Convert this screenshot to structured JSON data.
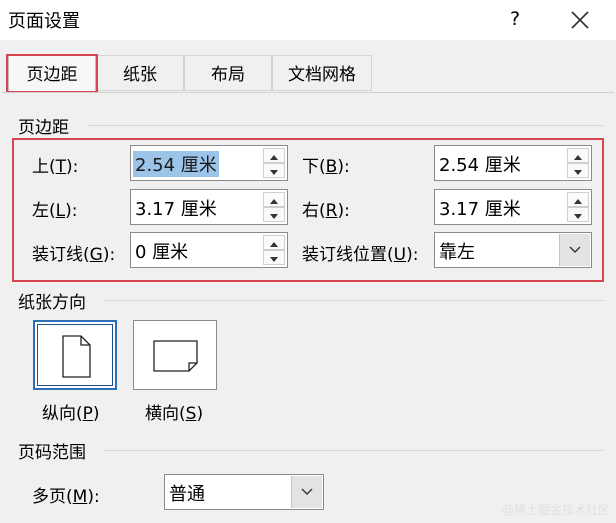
{
  "dialog": {
    "title": "页面设置",
    "help": "?",
    "close_icon": "close-icon"
  },
  "tabs": [
    {
      "label": "页边距",
      "active": true
    },
    {
      "label": "纸张",
      "active": false
    },
    {
      "label": "布局",
      "active": false
    },
    {
      "label": "文档网格",
      "active": false
    }
  ],
  "margins": {
    "section_title": "页边距",
    "top": {
      "label_pre": "上(",
      "key": "T",
      "label_post": "):",
      "value": "2.54 厘米"
    },
    "bottom": {
      "label_pre": "下(",
      "key": "B",
      "label_post": "):",
      "value": "2.54 厘米"
    },
    "left": {
      "label_pre": "左(",
      "key": "L",
      "label_post": "):",
      "value": "3.17 厘米"
    },
    "right": {
      "label_pre": "右(",
      "key": "R",
      "label_post": "):",
      "value": "3.17 厘米"
    },
    "gutter": {
      "label_pre": "装订线(",
      "key": "G",
      "label_post": "):",
      "value": "0 厘米"
    },
    "gutter_pos": {
      "label_pre": "装订线位置(",
      "key": "U",
      "label_post": "):",
      "value": "靠左"
    }
  },
  "orientation": {
    "section_title": "纸张方向",
    "portrait": {
      "label_pre": "纵向(",
      "key": "P",
      "label_post": ")",
      "selected": true
    },
    "landscape": {
      "label_pre": "横向(",
      "key": "S",
      "label_post": ")",
      "selected": false
    }
  },
  "pages": {
    "section_title": "页码范围",
    "multiple": {
      "label_pre": "多页(",
      "key": "M",
      "label_post": "):",
      "value": "普通"
    }
  },
  "watermark": "@稀土掘金技术社区",
  "colors": {
    "highlight": "#d64550",
    "selection": "#9cc4e8",
    "accent": "#2b6fb6"
  }
}
